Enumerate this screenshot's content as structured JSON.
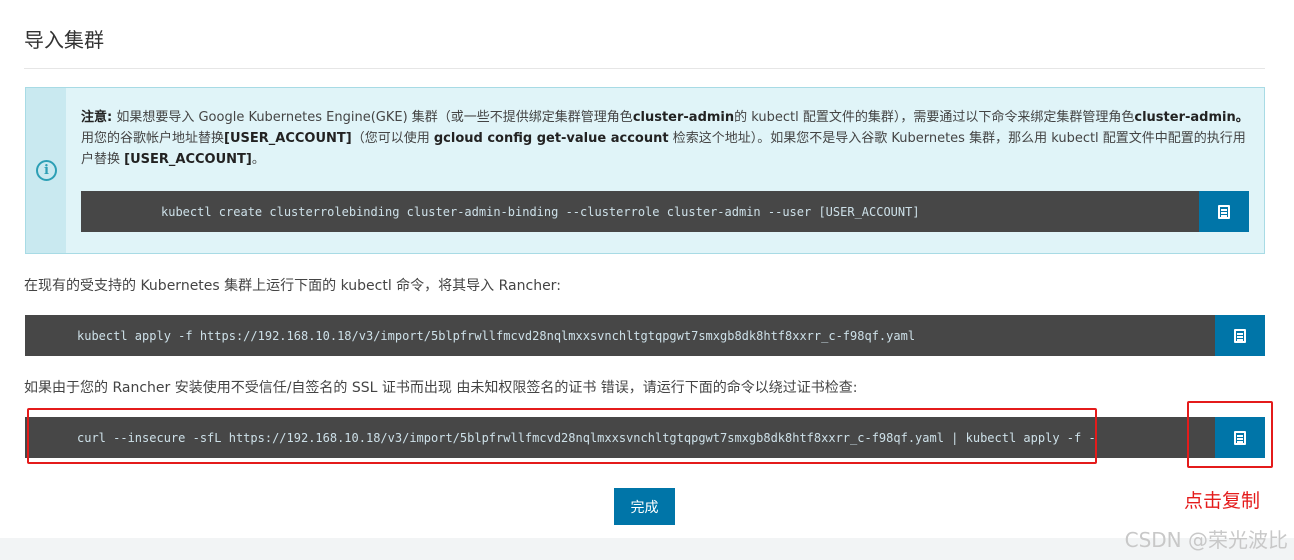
{
  "page": {
    "title": "导入集群"
  },
  "notice": {
    "icon": "info-icon",
    "label": "注意:",
    "t1": " 如果想要导入 Google Kubernetes Engine(GKE) 集群（或一些不提供绑定集群管理角色",
    "b1": "cluster-admin",
    "t2": "的 kubectl 配置文件的集群），需要通过以下命令来绑定集群管理角色",
    "b2": "cluster-admin。",
    "t3": " 用您的谷歌帐户地址替换",
    "b3": "[USER_ACCOUNT]",
    "t4": "（您可以使用 ",
    "b4": "gcloud config get-value account",
    "t5": " 检索这个地址）。如果您不是导入谷歌 Kubernetes 集群，那么用 kubectl 配置文件中配置的执行用户替换 ",
    "b5": "[USER_ACCOUNT]",
    "t6": "。",
    "command": "kubectl create clusterrolebinding cluster-admin-binding --clusterrole cluster-admin --user [USER_ACCOUNT]"
  },
  "section1": {
    "text": "在现有的受支持的 Kubernetes 集群上运行下面的 kubectl 命令，将其导入 Rancher:",
    "command": "kubectl apply -f https://192.168.10.18/v3/import/5blpfrwllfmcvd28nqlmxxsvnchltgtqpgwt7smxgb8dk8htf8xxrr_c-f98qf.yaml"
  },
  "section2": {
    "text": "如果由于您的 Rancher 安装使用不受信任/自签名的 SSL 证书而出现 由未知权限签名的证书 错误，请运行下面的命令以绕过证书检查:",
    "command": "curl --insecure -sfL https://192.168.10.18/v3/import/5blpfrwllfmcvd28nqlmxxsvnchltgtqpgwt7smxgb8dk8htf8xxrr_c-f98qf.yaml | kubectl apply -f -"
  },
  "copy_icon": "clipboard-icon",
  "annotation": {
    "label": "点击复制",
    "color": "#e41b1b"
  },
  "done_button": "完成",
  "watermark": "CSDN @荣光波比",
  "colors": {
    "accent": "#0075a8",
    "code_bg": "#474747",
    "info_bg": "#e0f4f8"
  }
}
